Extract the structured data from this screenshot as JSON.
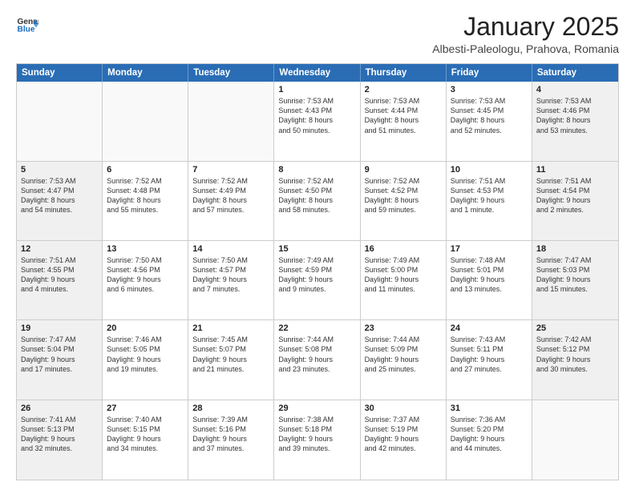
{
  "logo": {
    "line1": "General",
    "line2": "Blue"
  },
  "header": {
    "month": "January 2025",
    "location": "Albesti-Paleologu, Prahova, Romania"
  },
  "weekdays": [
    "Sunday",
    "Monday",
    "Tuesday",
    "Wednesday",
    "Thursday",
    "Friday",
    "Saturday"
  ],
  "weeks": [
    [
      {
        "day": "",
        "info": "",
        "empty": true
      },
      {
        "day": "",
        "info": "",
        "empty": true
      },
      {
        "day": "",
        "info": "",
        "empty": true
      },
      {
        "day": "1",
        "info": "Sunrise: 7:53 AM\nSunset: 4:43 PM\nDaylight: 8 hours\nand 50 minutes.",
        "empty": false
      },
      {
        "day": "2",
        "info": "Sunrise: 7:53 AM\nSunset: 4:44 PM\nDaylight: 8 hours\nand 51 minutes.",
        "empty": false
      },
      {
        "day": "3",
        "info": "Sunrise: 7:53 AM\nSunset: 4:45 PM\nDaylight: 8 hours\nand 52 minutes.",
        "empty": false
      },
      {
        "day": "4",
        "info": "Sunrise: 7:53 AM\nSunset: 4:46 PM\nDaylight: 8 hours\nand 53 minutes.",
        "empty": false,
        "shaded": true
      }
    ],
    [
      {
        "day": "5",
        "info": "Sunrise: 7:53 AM\nSunset: 4:47 PM\nDaylight: 8 hours\nand 54 minutes.",
        "empty": false,
        "shaded": true
      },
      {
        "day": "6",
        "info": "Sunrise: 7:52 AM\nSunset: 4:48 PM\nDaylight: 8 hours\nand 55 minutes.",
        "empty": false
      },
      {
        "day": "7",
        "info": "Sunrise: 7:52 AM\nSunset: 4:49 PM\nDaylight: 8 hours\nand 57 minutes.",
        "empty": false
      },
      {
        "day": "8",
        "info": "Sunrise: 7:52 AM\nSunset: 4:50 PM\nDaylight: 8 hours\nand 58 minutes.",
        "empty": false
      },
      {
        "day": "9",
        "info": "Sunrise: 7:52 AM\nSunset: 4:52 PM\nDaylight: 8 hours\nand 59 minutes.",
        "empty": false
      },
      {
        "day": "10",
        "info": "Sunrise: 7:51 AM\nSunset: 4:53 PM\nDaylight: 9 hours\nand 1 minute.",
        "empty": false
      },
      {
        "day": "11",
        "info": "Sunrise: 7:51 AM\nSunset: 4:54 PM\nDaylight: 9 hours\nand 2 minutes.",
        "empty": false,
        "shaded": true
      }
    ],
    [
      {
        "day": "12",
        "info": "Sunrise: 7:51 AM\nSunset: 4:55 PM\nDaylight: 9 hours\nand 4 minutes.",
        "empty": false,
        "shaded": true
      },
      {
        "day": "13",
        "info": "Sunrise: 7:50 AM\nSunset: 4:56 PM\nDaylight: 9 hours\nand 6 minutes.",
        "empty": false
      },
      {
        "day": "14",
        "info": "Sunrise: 7:50 AM\nSunset: 4:57 PM\nDaylight: 9 hours\nand 7 minutes.",
        "empty": false
      },
      {
        "day": "15",
        "info": "Sunrise: 7:49 AM\nSunset: 4:59 PM\nDaylight: 9 hours\nand 9 minutes.",
        "empty": false
      },
      {
        "day": "16",
        "info": "Sunrise: 7:49 AM\nSunset: 5:00 PM\nDaylight: 9 hours\nand 11 minutes.",
        "empty": false
      },
      {
        "day": "17",
        "info": "Sunrise: 7:48 AM\nSunset: 5:01 PM\nDaylight: 9 hours\nand 13 minutes.",
        "empty": false
      },
      {
        "day": "18",
        "info": "Sunrise: 7:47 AM\nSunset: 5:03 PM\nDaylight: 9 hours\nand 15 minutes.",
        "empty": false,
        "shaded": true
      }
    ],
    [
      {
        "day": "19",
        "info": "Sunrise: 7:47 AM\nSunset: 5:04 PM\nDaylight: 9 hours\nand 17 minutes.",
        "empty": false,
        "shaded": true
      },
      {
        "day": "20",
        "info": "Sunrise: 7:46 AM\nSunset: 5:05 PM\nDaylight: 9 hours\nand 19 minutes.",
        "empty": false
      },
      {
        "day": "21",
        "info": "Sunrise: 7:45 AM\nSunset: 5:07 PM\nDaylight: 9 hours\nand 21 minutes.",
        "empty": false
      },
      {
        "day": "22",
        "info": "Sunrise: 7:44 AM\nSunset: 5:08 PM\nDaylight: 9 hours\nand 23 minutes.",
        "empty": false
      },
      {
        "day": "23",
        "info": "Sunrise: 7:44 AM\nSunset: 5:09 PM\nDaylight: 9 hours\nand 25 minutes.",
        "empty": false
      },
      {
        "day": "24",
        "info": "Sunrise: 7:43 AM\nSunset: 5:11 PM\nDaylight: 9 hours\nand 27 minutes.",
        "empty": false
      },
      {
        "day": "25",
        "info": "Sunrise: 7:42 AM\nSunset: 5:12 PM\nDaylight: 9 hours\nand 30 minutes.",
        "empty": false,
        "shaded": true
      }
    ],
    [
      {
        "day": "26",
        "info": "Sunrise: 7:41 AM\nSunset: 5:13 PM\nDaylight: 9 hours\nand 32 minutes.",
        "empty": false,
        "shaded": true
      },
      {
        "day": "27",
        "info": "Sunrise: 7:40 AM\nSunset: 5:15 PM\nDaylight: 9 hours\nand 34 minutes.",
        "empty": false
      },
      {
        "day": "28",
        "info": "Sunrise: 7:39 AM\nSunset: 5:16 PM\nDaylight: 9 hours\nand 37 minutes.",
        "empty": false
      },
      {
        "day": "29",
        "info": "Sunrise: 7:38 AM\nSunset: 5:18 PM\nDaylight: 9 hours\nand 39 minutes.",
        "empty": false
      },
      {
        "day": "30",
        "info": "Sunrise: 7:37 AM\nSunset: 5:19 PM\nDaylight: 9 hours\nand 42 minutes.",
        "empty": false
      },
      {
        "day": "31",
        "info": "Sunrise: 7:36 AM\nSunset: 5:20 PM\nDaylight: 9 hours\nand 44 minutes.",
        "empty": false
      },
      {
        "day": "",
        "info": "",
        "empty": true
      }
    ]
  ]
}
